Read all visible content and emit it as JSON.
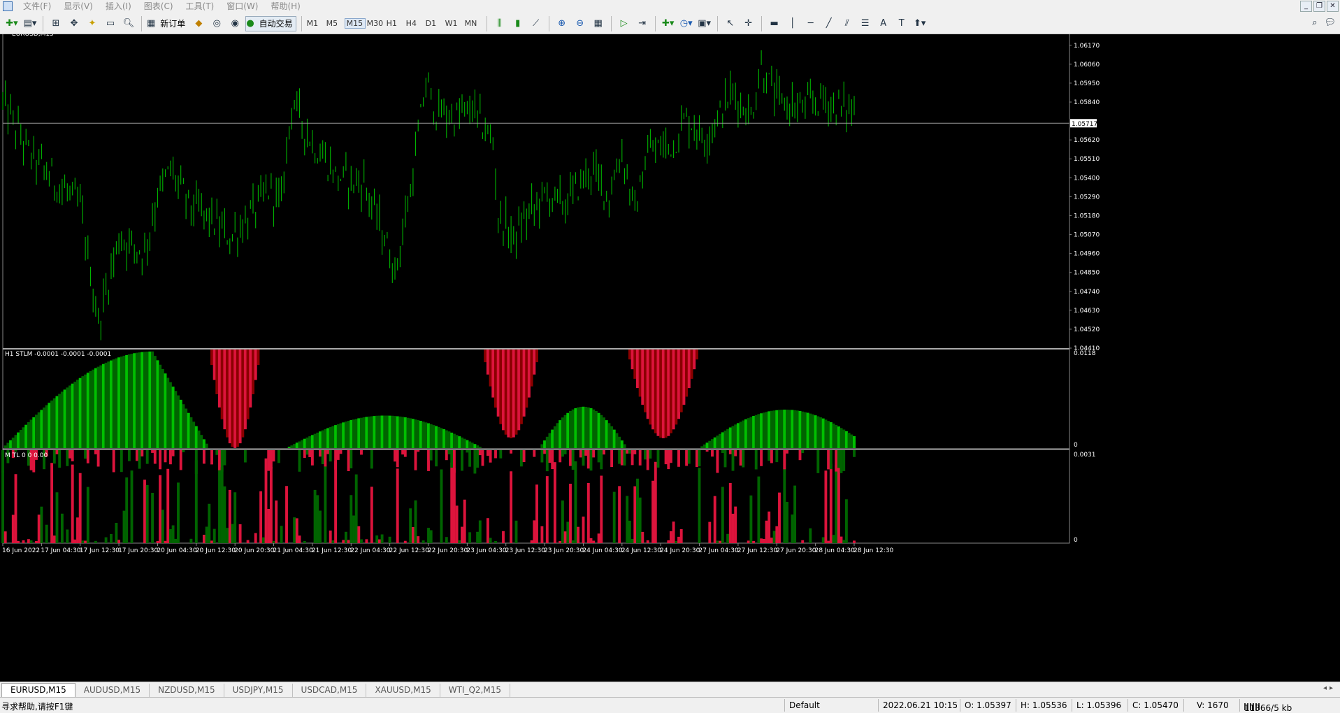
{
  "menu": {
    "items": [
      "文件(F)",
      "显示(V)",
      "插入(I)",
      "图表(C)",
      "工具(T)",
      "窗口(W)",
      "帮助(H)"
    ]
  },
  "toolbar": {
    "new_order_label": "新订单",
    "auto_trade_label": "自动交易",
    "timeframes": [
      "M1",
      "M5",
      "M15",
      "M30",
      "H1",
      "H4",
      "D1",
      "W1",
      "MN"
    ],
    "selected_timeframe": "M15"
  },
  "chart": {
    "symbol_title": "EURUSD,M15",
    "price_axis": [
      "1.06170",
      "1.06060",
      "1.05950",
      "1.05840",
      "1.05620",
      "1.05510",
      "1.05400",
      "1.05290",
      "1.05180",
      "1.05070",
      "1.04960",
      "1.04850",
      "1.04740",
      "1.04630",
      "1.04520",
      "1.04410"
    ],
    "current_price": "1.05717",
    "time_axis": [
      "16 Jun 2022",
      "17 Jun 04:30",
      "17 Jun 12:30",
      "17 Jun 20:30",
      "20 Jun 04:30",
      "20 Jun 12:30",
      "20 Jun 20:30",
      "21 Jun 04:30",
      "21 Jun 12:30",
      "22 Jun 04:30",
      "22 Jun 12:30",
      "22 Jun 20:30",
      "23 Jun 04:30",
      "23 Jun 12:30",
      "23 Jun 20:30",
      "24 Jun 04:30",
      "24 Jun 12:30",
      "24 Jun 20:30",
      "27 Jun 04:30",
      "27 Jun 12:30",
      "27 Jun 20:30",
      "28 Jun 04:30",
      "28 Jun 12:30"
    ],
    "indicator1": {
      "label": "H1 STLM -0.0001 -0.0001 -0.0001",
      "scale_top": "0.0118",
      "scale_zero": "0"
    },
    "indicator2": {
      "label": "M   TL   0   0   0.00",
      "scale_top": "0.0031",
      "scale_zero": "0"
    },
    "colors": {
      "candle": "#00b400",
      "hist_up": "#006400",
      "hist_up_light": "#00c000",
      "hist_down": "#dc143c",
      "hist_down_dark": "#8b0000",
      "hist_edge": "#ff3030"
    }
  },
  "chart_data": {
    "type": "candlestick",
    "symbol": "EURUSD",
    "timeframe": "M15",
    "ylim": [
      1.0441,
      1.0623
    ],
    "current_price": 1.05717,
    "close_path": [
      [
        0,
        1.0584
      ],
      [
        10,
        1.0555
      ],
      [
        20,
        1.0538
      ],
      [
        30,
        1.0524
      ],
      [
        37,
        1.0455
      ],
      [
        45,
        1.0505
      ],
      [
        55,
        1.0497
      ],
      [
        60,
        1.053
      ],
      [
        65,
        1.0545
      ],
      [
        72,
        1.0525
      ],
      [
        80,
        1.0517
      ],
      [
        88,
        1.0505
      ],
      [
        96,
        1.0518
      ],
      [
        103,
        1.0533
      ],
      [
        108,
        1.0526
      ],
      [
        112,
        1.0585
      ],
      [
        120,
        1.056
      ],
      [
        130,
        1.054
      ],
      [
        140,
        1.0537
      ],
      [
        148,
        1.0505
      ],
      [
        152,
        1.0485
      ],
      [
        158,
        1.0532
      ],
      [
        164,
        1.0595
      ],
      [
        168,
        1.0578
      ],
      [
        175,
        1.0575
      ],
      [
        182,
        1.058
      ],
      [
        190,
        1.056
      ],
      [
        192,
        1.0518
      ],
      [
        198,
        1.0505
      ],
      [
        202,
        1.0515
      ],
      [
        210,
        1.053
      ],
      [
        218,
        1.0525
      ],
      [
        228,
        1.0545
      ],
      [
        235,
        1.053
      ],
      [
        240,
        1.0555
      ],
      [
        245,
        1.052
      ],
      [
        250,
        1.0555
      ],
      [
        260,
        1.056
      ],
      [
        265,
        1.0575
      ],
      [
        272,
        1.0563
      ],
      [
        278,
        1.0577
      ],
      [
        283,
        1.059
      ],
      [
        290,
        1.0575
      ],
      [
        294,
        1.0605
      ],
      [
        300,
        1.0585
      ],
      [
        310,
        1.058
      ],
      [
        318,
        1.0586
      ],
      [
        325,
        1.058
      ],
      [
        330,
        1.058
      ]
    ],
    "stlm_histogram_scale": [
      0,
      0.0118
    ],
    "second_histogram_scale": [
      0,
      0.0031
    ]
  },
  "tabs": [
    "EURUSD,M15",
    "AUDUSD,M15",
    "NZDUSD,M15",
    "USDJPY,M15",
    "USDCAD,M15",
    "XAUUSD,M15",
    "WTI_Q2,M15"
  ],
  "status": {
    "help": "寻求帮助,请按F1键",
    "profile": "Default",
    "datetime": "2022.06.21 10:15",
    "open": "O: 1.05397",
    "high": "H: 1.05536",
    "low": "L: 1.05396",
    "close": "C: 1.05470",
    "volume": "V: 1670",
    "traffic": "11366/5 kb"
  }
}
